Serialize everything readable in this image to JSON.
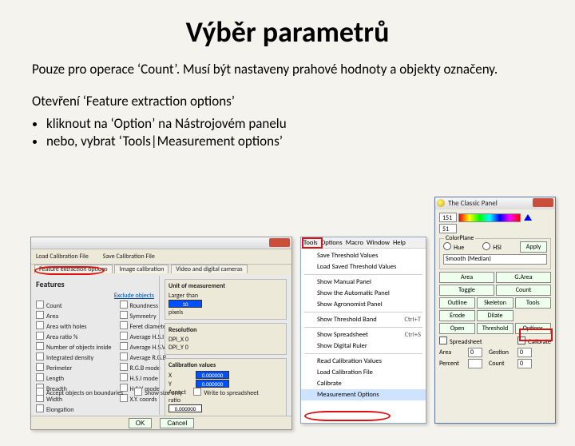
{
  "title": "Výběr parametrů",
  "para1": "Pouze pro operace ‘Count’. Musí být nastaveny prahové hodnoty a objekty označeny.",
  "para2": "Otevření ‘Feature extraction options’",
  "bullets": [
    "kliknout na ‘Option’ na Nástrojovém panelu",
    "nebo, vybrat ‘Tools|Measurement options’"
  ],
  "dlg1": {
    "toolbar": {
      "load": "Load Calibration File",
      "save": "Save Calibration File"
    },
    "tabs": [
      "Feature extraction options",
      "Image calibration",
      "Video and digital cameras"
    ],
    "features_heading": "Features",
    "exclude_link": "Exclude objects",
    "col1": [
      "Count",
      "Area",
      "Area with holes",
      "Area ratio %",
      "Number of objects inside",
      "Integrated density",
      "Perimeter",
      "Length",
      "Breadth",
      "Width",
      "Elongation"
    ],
    "col2": [
      "Roundness",
      "Symmetry",
      "Feret diameters",
      "Average H.S.I",
      "Average H.S.V",
      "Average R.G.B",
      "R.G.B mode",
      "H.S.I mode",
      "H.S.V mode",
      "X.Y. coords"
    ],
    "footer_checks": [
      "Accept objects on boundaries",
      "Show size only",
      "Write to spreadsheet"
    ],
    "unit_title": "Unit of measurement",
    "larger": "Larger than",
    "larger_val": "10",
    "pixels": "pixels",
    "res_title": "Resolution",
    "res_x": "DPI_X   0",
    "res_y": "DPI_Y   0",
    "calib_title": "Calibration values",
    "valX": "0.000000",
    "valY": "0.000000",
    "aspect_lbl": "Aspect ratio",
    "aspect_val": "0.000000",
    "ok": "OK",
    "cancel": "Cancel"
  },
  "dlg2": {
    "menubar": [
      "Tools",
      "Options",
      "Macro",
      "Window",
      "Help"
    ],
    "items": [
      {
        "t": "Save Threshold Values"
      },
      {
        "t": "Load Saved Threshold Values"
      },
      {
        "sep": true
      },
      {
        "t": "Show Manual Panel"
      },
      {
        "t": "Show the Automatic Panel"
      },
      {
        "t": "Show Agronomist Panel"
      },
      {
        "sep": true
      },
      {
        "t": "Show Threshold Band",
        "sc": "Ctrl+T",
        "checked": true
      },
      {
        "sep": true
      },
      {
        "t": "Show Spreadsheet",
        "sc": "Ctrl+S"
      },
      {
        "t": "Show Digital Ruler"
      },
      {
        "sep": true
      },
      {
        "t": "Read Calibration Values"
      },
      {
        "t": "Load Calibration File"
      },
      {
        "t": "Calibrate"
      },
      {
        "t": "Measurement Options",
        "sel": true
      }
    ]
  },
  "dlg3": {
    "title": "The Classic Panel",
    "spin1": "151",
    "spin2": "51",
    "colorplane_title": "ColorPlane",
    "radio_hue": "Hue",
    "radio_hsi": "HSI",
    "apply": "Apply",
    "smooth": "Smooth (Median)",
    "btn_area": "Area",
    "btn_garea": "G.Area",
    "btn_toggle": "Toggle",
    "btn_count": "Count",
    "btn_outline": "Outline",
    "btn_skeleton": "Skeleton",
    "btn_tools": "Tools",
    "btn_erode": "Erode",
    "btn_dilate": "Dilate",
    "btn_open": "Open",
    "btn_threshold": "Threshold",
    "btn_options": "Options",
    "chk_spread": "Spreadsheet",
    "chk_calib": "Calibrate",
    "area_lbl": "Area",
    "area_val": "0",
    "gestion_lbl": "Gestion",
    "gestion_val": "0",
    "percent_lbl": "Percent",
    "percent_val": " ",
    "count_lbl": "Count",
    "count_val": "0"
  }
}
